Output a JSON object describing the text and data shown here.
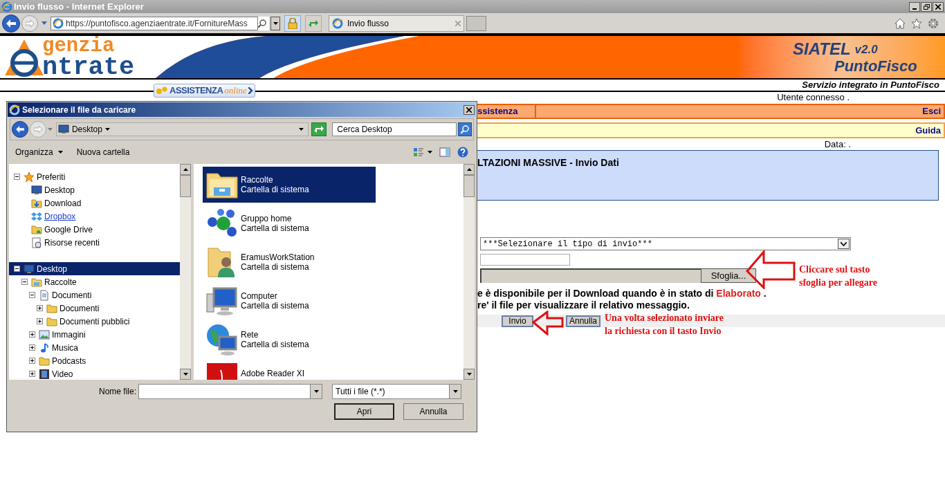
{
  "browser": {
    "title": "Invio flusso - Internet Explorer",
    "address": "https://puntofisco.agenziaentrate.it/FornitureMass",
    "tabs": [
      {
        "label": "Invio flusso",
        "selected": true
      }
    ]
  },
  "header": {
    "logo_top": "genzia",
    "logo_bottom": "ntrate",
    "assist_main": "ASSISTENZA",
    "assist_tail": "online",
    "product": "SIATEL",
    "version": "v2.0",
    "suite": "PuntoFisco",
    "tagline": "Servizio integrato in PuntoFisco"
  },
  "user_line": "Utente connesso .",
  "menu": {
    "items": [
      "ssistenza"
    ],
    "exit": "Esci"
  },
  "help_link": "Guida",
  "date_line": "Data: .",
  "panel_title": "LTAZIONI MASSIVE - Invio Dati",
  "form": {
    "send_type": "***Selezionare il tipo di invio***",
    "browse_button": "Sfoglia...",
    "notice": [
      {
        "segments": [
          {
            "text": "e è disponibile per il Download quando è in stato di ",
            "kind": "plain"
          },
          {
            "text": "Elaborato",
            "kind": "status"
          },
          {
            "text": " .",
            "kind": "plain"
          }
        ]
      },
      {
        "segments": [
          {
            "text": "re' il file per visualizzare il relativo messaggio.",
            "kind": "plain"
          }
        ]
      }
    ],
    "buttons": [
      "Invio",
      "Annulla"
    ]
  },
  "annotations": [
    {
      "text": "Cliccare sul tasto sfoglia per allegare"
    },
    {
      "text": "Una volta selezionato inviare la richiesta con il tasto Invio"
    }
  ],
  "dialog": {
    "title": "Selezionare il file da caricare",
    "location": "Desktop",
    "search": {
      "placeholder": "Cerca Desktop"
    },
    "toolbar": [
      {
        "label": "Organizza",
        "kind": "menu"
      },
      {
        "label": "Nuova cartella",
        "kind": "button"
      }
    ],
    "tree": [
      {
        "label": "Preferiti",
        "kind": "star",
        "expanded": true,
        "selected": false,
        "hovered": false,
        "children": [
          {
            "label": "Desktop",
            "kind": "desktop",
            "selected": false,
            "hovered": false
          },
          {
            "label": "Download",
            "kind": "download",
            "selected": false,
            "hovered": false
          },
          {
            "label": "Dropbox",
            "kind": "dropbox",
            "selected": false,
            "hovered": true
          },
          {
            "label": "Google Drive",
            "kind": "drive",
            "selected": false,
            "hovered": false
          },
          {
            "label": "Risorse recenti",
            "kind": "recent",
            "selected": false,
            "hovered": false
          }
        ]
      },
      {
        "label": "Desktop",
        "kind": "desktop",
        "expanded": true,
        "selected": true,
        "hovered": false,
        "children": [
          {
            "label": "Raccolte",
            "kind": "library",
            "expanded": true,
            "selected": false,
            "hovered": false,
            "children": [
              {
                "label": "Documenti",
                "kind": "document",
                "expanded": true,
                "selected": false,
                "hovered": false,
                "children": [
                  {
                    "label": "Documenti",
                    "kind": "folder",
                    "expanded": false,
                    "selected": false,
                    "hovered": false
                  },
                  {
                    "label": "Documenti pubblici",
                    "kind": "folder",
                    "expanded": false,
                    "selected": false,
                    "hovered": false
                  }
                ]
              },
              {
                "label": "Immagini",
                "kind": "pictures",
                "expanded": false,
                "selected": false,
                "hovered": false
              },
              {
                "label": "Musica",
                "kind": "music",
                "expanded": false,
                "selected": false,
                "hovered": false
              },
              {
                "label": "Podcasts",
                "kind": "folder",
                "expanded": false,
                "selected": false,
                "hovered": false
              },
              {
                "label": "Video",
                "kind": "video",
                "expanded": false,
                "selected": false,
                "hovered": false
              }
            ]
          }
        ]
      }
    ],
    "files": [
      {
        "name": "Raccolte",
        "type": "Cartella di sistema",
        "kind": "library",
        "selected": true
      },
      {
        "name": "Gruppo home",
        "type": "Cartella di sistema",
        "kind": "homegroup",
        "selected": false
      },
      {
        "name": "EramusWorkStation",
        "type": "Cartella di sistema",
        "kind": "user",
        "selected": false
      },
      {
        "name": "Computer",
        "type": "Cartella di sistema",
        "kind": "computer",
        "selected": false
      },
      {
        "name": "Rete",
        "type": "Cartella di sistema",
        "kind": "network",
        "selected": false
      },
      {
        "name": "Adobe Reader XI",
        "kind": "pdf",
        "selected": false
      }
    ],
    "file_name_label": "Nome file:",
    "file_type": "Tutti i file (*.*)",
    "buttons": [
      {
        "label": "Apri",
        "kind": "default"
      },
      {
        "label": "Annulla",
        "kind": "normal"
      }
    ]
  }
}
